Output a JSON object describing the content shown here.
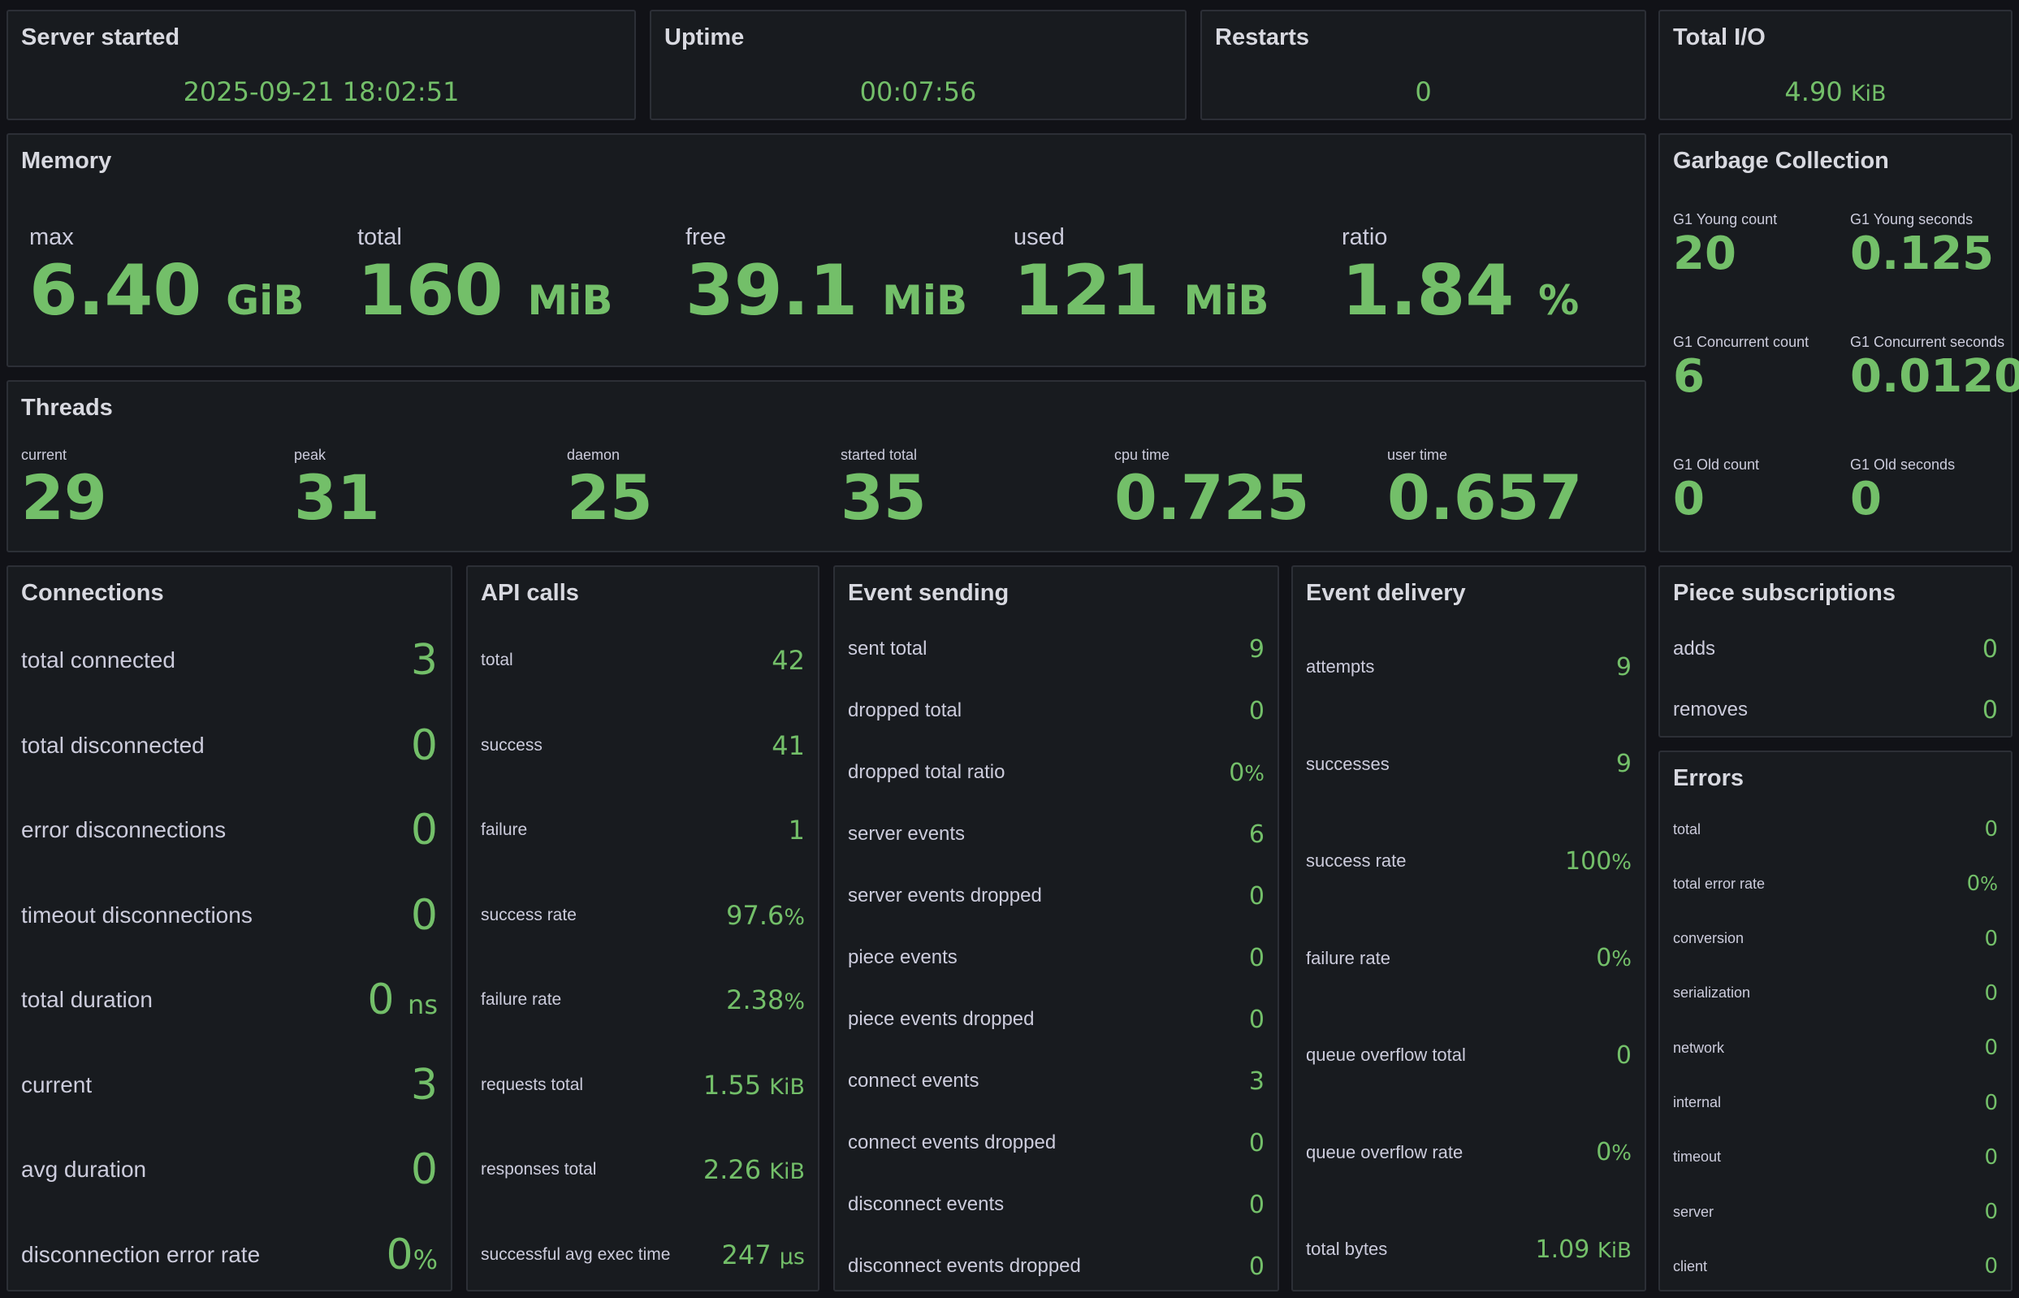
{
  "server_started": {
    "title": "Server started",
    "value": "2025-09-21 18:02:51"
  },
  "uptime": {
    "title": "Uptime",
    "value": "00:07:56"
  },
  "restarts": {
    "title": "Restarts",
    "value": "0"
  },
  "total_io": {
    "title": "Total I/O",
    "value": "4.90",
    "unit": "KiB"
  },
  "memory": {
    "title": "Memory",
    "items": [
      {
        "label": "max",
        "value": "6.40",
        "unit": "GiB"
      },
      {
        "label": "total",
        "value": "160",
        "unit": "MiB"
      },
      {
        "label": "free",
        "value": "39.1",
        "unit": "MiB"
      },
      {
        "label": "used",
        "value": "121",
        "unit": "MiB"
      },
      {
        "label": "ratio",
        "value": "1.84",
        "unit": "%"
      }
    ]
  },
  "gc": {
    "title": "Garbage Collection",
    "items": [
      {
        "label": "G1 Young count",
        "value": "20"
      },
      {
        "label": "G1 Young seconds",
        "value": "0.125"
      },
      {
        "label": "G1 Concurrent count",
        "value": "6"
      },
      {
        "label": "G1 Concurrent seconds",
        "value": "0.0120"
      },
      {
        "label": "G1 Old count",
        "value": "0"
      },
      {
        "label": "G1 Old seconds",
        "value": "0"
      }
    ]
  },
  "threads": {
    "title": "Threads",
    "items": [
      {
        "label": "current",
        "value": "29"
      },
      {
        "label": "peak",
        "value": "31"
      },
      {
        "label": "daemon",
        "value": "25"
      },
      {
        "label": "started total",
        "value": "35"
      },
      {
        "label": "cpu time",
        "value": "0.725"
      },
      {
        "label": "user time",
        "value": "0.657"
      }
    ]
  },
  "connections": {
    "title": "Connections",
    "items": [
      {
        "label": "total connected",
        "value": "3",
        "unit": ""
      },
      {
        "label": "total disconnected",
        "value": "0",
        "unit": ""
      },
      {
        "label": "error disconnections",
        "value": "0",
        "unit": ""
      },
      {
        "label": "timeout disconnections",
        "value": "0",
        "unit": ""
      },
      {
        "label": "total duration",
        "value": "0",
        "unit": "ns"
      },
      {
        "label": "current",
        "value": "3",
        "unit": ""
      },
      {
        "label": "avg duration",
        "value": "0",
        "unit": ""
      },
      {
        "label": "disconnection error rate",
        "value": "0",
        "unit": "%"
      }
    ]
  },
  "api_calls": {
    "title": "API calls",
    "items": [
      {
        "label": "total",
        "value": "42",
        "unit": ""
      },
      {
        "label": "success",
        "value": "41",
        "unit": ""
      },
      {
        "label": "failure",
        "value": "1",
        "unit": ""
      },
      {
        "label": "success rate",
        "value": "97.6",
        "unit": "%"
      },
      {
        "label": "failure rate",
        "value": "2.38",
        "unit": "%"
      },
      {
        "label": "requests total",
        "value": "1.55",
        "unit": "KiB"
      },
      {
        "label": "responses total",
        "value": "2.26",
        "unit": "KiB"
      },
      {
        "label": "successful avg exec time",
        "value": "247",
        "unit": "µs"
      }
    ]
  },
  "event_sending": {
    "title": "Event sending",
    "items": [
      {
        "label": "sent total",
        "value": "9",
        "unit": ""
      },
      {
        "label": "dropped total",
        "value": "0",
        "unit": ""
      },
      {
        "label": "dropped total ratio",
        "value": "0",
        "unit": "%"
      },
      {
        "label": "server events",
        "value": "6",
        "unit": ""
      },
      {
        "label": "server events dropped",
        "value": "0",
        "unit": ""
      },
      {
        "label": "piece events",
        "value": "0",
        "unit": ""
      },
      {
        "label": "piece events dropped",
        "value": "0",
        "unit": ""
      },
      {
        "label": "connect events",
        "value": "3",
        "unit": ""
      },
      {
        "label": "connect events dropped",
        "value": "0",
        "unit": ""
      },
      {
        "label": "disconnect events",
        "value": "0",
        "unit": ""
      },
      {
        "label": "disconnect events dropped",
        "value": "0",
        "unit": ""
      }
    ]
  },
  "event_delivery": {
    "title": "Event delivery",
    "items": [
      {
        "label": "attempts",
        "value": "9",
        "unit": ""
      },
      {
        "label": "successes",
        "value": "9",
        "unit": ""
      },
      {
        "label": "success rate",
        "value": "100",
        "unit": "%"
      },
      {
        "label": "failure rate",
        "value": "0",
        "unit": "%"
      },
      {
        "label": "queue overflow total",
        "value": "0",
        "unit": ""
      },
      {
        "label": "queue overflow rate",
        "value": "0",
        "unit": "%"
      },
      {
        "label": "total bytes",
        "value": "1.09",
        "unit": "KiB"
      }
    ]
  },
  "piece_subscriptions": {
    "title": "Piece subscriptions",
    "items": [
      {
        "label": "adds",
        "value": "0",
        "unit": ""
      },
      {
        "label": "removes",
        "value": "0",
        "unit": ""
      }
    ]
  },
  "errors": {
    "title": "Errors",
    "items": [
      {
        "label": "total",
        "value": "0",
        "unit": ""
      },
      {
        "label": "total error rate",
        "value": "0",
        "unit": "%"
      },
      {
        "label": "conversion",
        "value": "0",
        "unit": ""
      },
      {
        "label": "serialization",
        "value": "0",
        "unit": ""
      },
      {
        "label": "network",
        "value": "0",
        "unit": ""
      },
      {
        "label": "internal",
        "value": "0",
        "unit": ""
      },
      {
        "label": "timeout",
        "value": "0",
        "unit": ""
      },
      {
        "label": "server",
        "value": "0",
        "unit": ""
      },
      {
        "label": "client",
        "value": "0",
        "unit": ""
      }
    ]
  },
  "colors": {
    "value_green": "#73bf69",
    "panel_bg": "#181b1f",
    "page_bg": "#111217",
    "border": "#2c2f36"
  }
}
